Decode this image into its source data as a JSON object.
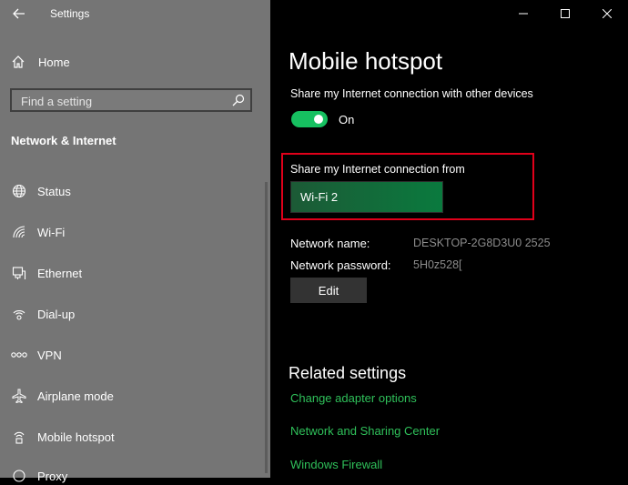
{
  "window": {
    "app_title": "Settings",
    "controls": [
      "minimize",
      "maximize",
      "close"
    ]
  },
  "sidebar": {
    "home_label": "Home",
    "search": {
      "placeholder": "Find a setting"
    },
    "section_title": "Network & Internet",
    "items": [
      {
        "label": "Status",
        "icon": "globe-icon"
      },
      {
        "label": "Wi-Fi",
        "icon": "wifi-icon"
      },
      {
        "label": "Ethernet",
        "icon": "ethernet-icon"
      },
      {
        "label": "Dial-up",
        "icon": "dialup-icon"
      },
      {
        "label": "VPN",
        "icon": "vpn-icon"
      },
      {
        "label": "Airplane mode",
        "icon": "airplane-icon"
      },
      {
        "label": "Mobile hotspot",
        "icon": "hotspot-icon"
      },
      {
        "label": "Proxy",
        "icon": "proxy-icon"
      }
    ]
  },
  "main": {
    "title": "Mobile hotspot",
    "share_label": "Share my Internet connection with other devices",
    "toggle_state": "On",
    "toggle_on": true,
    "share_from_label": "Share my Internet connection from",
    "share_from_value": "Wi-Fi 2",
    "network_name_label": "Network name:",
    "network_name_value": "DESKTOP-2G8D3U0 2525",
    "network_password_label": "Network password:",
    "network_password_value": "5H0z528[",
    "edit_label": "Edit",
    "related_title": "Related settings",
    "related_links": [
      "Change adapter options",
      "Network and Sharing Center",
      "Windows Firewall"
    ]
  },
  "colors": {
    "sidebar_bg": "#757575",
    "main_bg": "#000000",
    "accent_green": "#16c060",
    "link_green": "#2fc05a",
    "highlight_red": "#e0001a"
  }
}
